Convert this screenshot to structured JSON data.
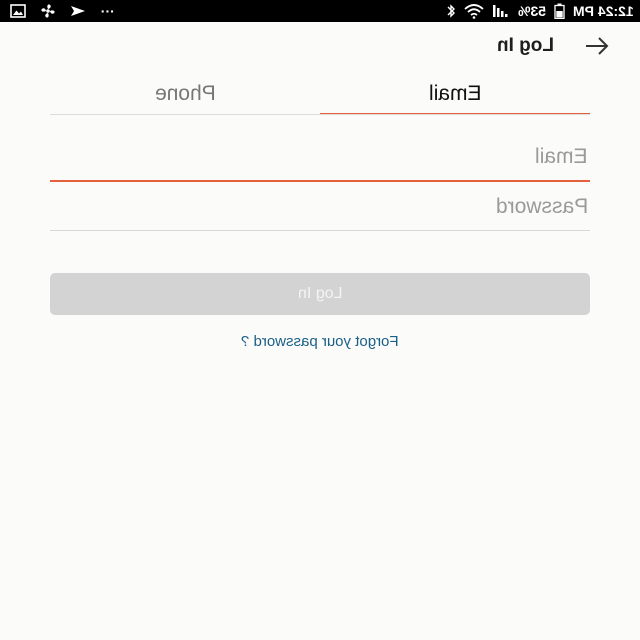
{
  "status_bar": {
    "time": "12:24 PM",
    "battery": "53%",
    "dots": "···",
    "icons": [
      "image-icon",
      "fan-icon",
      "navigation-icon",
      "overflow-dots-icon",
      "bluetooth-icon",
      "wifi-icon",
      "signal-icon",
      "battery-icon"
    ]
  },
  "header": {
    "title": "Log In",
    "back_icon": "arrow-back-icon"
  },
  "tabs": [
    {
      "label": "Email",
      "active": true
    },
    {
      "label": "Phone",
      "active": false
    }
  ],
  "form": {
    "email_placeholder": "Email",
    "password_placeholder": "Password",
    "submit_label": "Log In",
    "forgot_label": "Forgot your password ?"
  },
  "colors": {
    "accent": "#e5603b",
    "link": "#1a5f86",
    "button_disabled": "#d3d3d3",
    "background": "#fbfbf9"
  }
}
